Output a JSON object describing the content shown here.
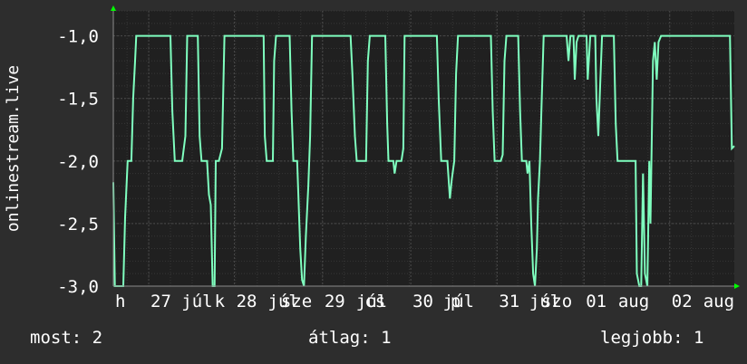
{
  "chart_data": {
    "type": "line",
    "ylabel": "onlinestream.live",
    "ylim": [
      -3.0,
      -0.8
    ],
    "y_ticks": [
      {
        "value": -1.0,
        "label": "-1,0"
      },
      {
        "value": -1.5,
        "label": "-1,5"
      },
      {
        "value": -2.0,
        "label": "-2,0"
      },
      {
        "value": -2.5,
        "label": "-2,5"
      },
      {
        "value": -3.0,
        "label": "-3,0"
      }
    ],
    "xlim": [
      0,
      100
    ],
    "x_ticks": [
      {
        "value": 0.0,
        "label": "h"
      },
      {
        "value": 5.7,
        "label": "27"
      },
      {
        "value": 10.7,
        "label": "júl"
      },
      {
        "value": 16.0,
        "label": "k"
      },
      {
        "value": 19.5,
        "label": "28"
      },
      {
        "value": 24.6,
        "label": "júl"
      },
      {
        "value": 26.7,
        "label": "sze"
      },
      {
        "value": 33.7,
        "label": "29"
      },
      {
        "value": 38.8,
        "label": "júl"
      },
      {
        "value": 40.2,
        "label": "cs"
      },
      {
        "value": 47.9,
        "label": "30"
      },
      {
        "value": 52.8,
        "label": "júl"
      },
      {
        "value": 54.0,
        "label": "p"
      },
      {
        "value": 61.8,
        "label": "31"
      },
      {
        "value": 66.7,
        "label": "júl"
      },
      {
        "value": 68.6,
        "label": "szo"
      },
      {
        "value": 75.8,
        "label": "01"
      },
      {
        "value": 81.0,
        "label": "aug"
      },
      {
        "value": 89.6,
        "label": "02"
      },
      {
        "value": 94.7,
        "label": "aug"
      }
    ],
    "grid": true,
    "series": [
      {
        "color": "#7fffbf",
        "points": [
          [
            0.0,
            -2.17
          ],
          [
            0.25,
            -3.0
          ],
          [
            1.6,
            -3.0
          ],
          [
            1.9,
            -2.45
          ],
          [
            2.3,
            -2.0
          ],
          [
            2.9,
            -2.0
          ],
          [
            3.2,
            -1.5
          ],
          [
            3.5,
            -1.2
          ],
          [
            3.7,
            -1.0
          ],
          [
            9.2,
            -1.0
          ],
          [
            9.5,
            -1.6
          ],
          [
            9.9,
            -2.0
          ],
          [
            11.1,
            -2.0
          ],
          [
            11.6,
            -1.8
          ],
          [
            11.9,
            -1.0
          ],
          [
            13.6,
            -1.0
          ],
          [
            13.9,
            -1.8
          ],
          [
            14.2,
            -2.0
          ],
          [
            15.1,
            -2.0
          ],
          [
            15.4,
            -2.27
          ],
          [
            15.7,
            -2.35
          ],
          [
            16.0,
            -3.0
          ],
          [
            16.3,
            -3.0
          ],
          [
            16.5,
            -2.0
          ],
          [
            17.0,
            -2.0
          ],
          [
            17.5,
            -1.9
          ],
          [
            17.9,
            -1.0
          ],
          [
            24.2,
            -1.0
          ],
          [
            24.4,
            -1.8
          ],
          [
            24.7,
            -2.0
          ],
          [
            25.7,
            -2.0
          ],
          [
            25.9,
            -1.2
          ],
          [
            26.2,
            -1.0
          ],
          [
            28.4,
            -1.0
          ],
          [
            28.7,
            -1.6
          ],
          [
            29.0,
            -2.0
          ],
          [
            29.6,
            -2.0
          ],
          [
            30.1,
            -2.7
          ],
          [
            30.4,
            -2.95
          ],
          [
            30.7,
            -3.0
          ],
          [
            31.0,
            -2.6
          ],
          [
            31.4,
            -2.2
          ],
          [
            31.7,
            -1.8
          ],
          [
            32.0,
            -1.0
          ],
          [
            38.2,
            -1.0
          ],
          [
            38.5,
            -1.3
          ],
          [
            38.9,
            -1.8
          ],
          [
            39.2,
            -2.0
          ],
          [
            40.7,
            -2.0
          ],
          [
            41.0,
            -1.2
          ],
          [
            41.3,
            -1.0
          ],
          [
            43.8,
            -1.0
          ],
          [
            44.1,
            -1.7
          ],
          [
            44.3,
            -2.0
          ],
          [
            45.1,
            -2.0
          ],
          [
            45.3,
            -2.1
          ],
          [
            45.6,
            -2.0
          ],
          [
            46.4,
            -2.0
          ],
          [
            46.7,
            -1.9
          ],
          [
            46.9,
            -1.0
          ],
          [
            52.1,
            -1.0
          ],
          [
            52.4,
            -1.5
          ],
          [
            52.8,
            -2.0
          ],
          [
            53.8,
            -2.0
          ],
          [
            54.2,
            -2.3
          ],
          [
            54.5,
            -2.15
          ],
          [
            54.9,
            -2.0
          ],
          [
            55.2,
            -1.3
          ],
          [
            55.5,
            -1.0
          ],
          [
            60.8,
            -1.0
          ],
          [
            61.1,
            -1.6
          ],
          [
            61.4,
            -2.0
          ],
          [
            62.4,
            -2.0
          ],
          [
            62.7,
            -1.95
          ],
          [
            63.0,
            -1.2
          ],
          [
            63.3,
            -1.0
          ],
          [
            65.2,
            -1.0
          ],
          [
            65.5,
            -1.6
          ],
          [
            65.8,
            -2.0
          ],
          [
            66.5,
            -2.0
          ],
          [
            66.7,
            -2.1
          ],
          [
            67.0,
            -2.0
          ],
          [
            67.3,
            -2.5
          ],
          [
            67.6,
            -2.9
          ],
          [
            67.9,
            -3.0
          ],
          [
            68.2,
            -2.7
          ],
          [
            68.4,
            -2.3
          ],
          [
            68.7,
            -2.0
          ],
          [
            69.0,
            -1.5
          ],
          [
            69.3,
            -1.0
          ],
          [
            73.0,
            -1.0
          ],
          [
            73.3,
            -1.2
          ],
          [
            73.6,
            -1.0
          ],
          [
            74.1,
            -1.0
          ],
          [
            74.3,
            -1.35
          ],
          [
            74.6,
            -1.05
          ],
          [
            74.9,
            -1.0
          ],
          [
            76.2,
            -1.0
          ],
          [
            76.4,
            -1.35
          ],
          [
            76.8,
            -1.0
          ],
          [
            77.6,
            -1.0
          ],
          [
            77.8,
            -1.5
          ],
          [
            78.1,
            -1.8
          ],
          [
            78.4,
            -1.4
          ],
          [
            78.7,
            -1.0
          ],
          [
            80.6,
            -1.0
          ],
          [
            80.9,
            -1.7
          ],
          [
            81.2,
            -2.0
          ],
          [
            84.1,
            -2.0
          ],
          [
            84.3,
            -2.9
          ],
          [
            84.7,
            -3.0
          ],
          [
            85.0,
            -3.0
          ],
          [
            85.3,
            -2.1
          ],
          [
            85.6,
            -2.9
          ],
          [
            86.0,
            -3.0
          ],
          [
            86.3,
            -2.0
          ],
          [
            86.5,
            -2.5
          ],
          [
            86.9,
            -1.2
          ],
          [
            87.2,
            -1.05
          ],
          [
            87.5,
            -1.35
          ],
          [
            87.8,
            -1.05
          ],
          [
            88.2,
            -1.0
          ],
          [
            99.3,
            -1.0
          ],
          [
            99.6,
            -1.9
          ],
          [
            100.0,
            -1.88
          ]
        ]
      }
    ]
  },
  "footer": {
    "current": "most: 2",
    "average": "átlag: 1",
    "best": "legjobb: 1"
  },
  "colors": {
    "background": "#2d2d2d",
    "plot_background": "#202020",
    "grid_major": "#4a4a4a",
    "grid_minor": "#363636",
    "line": "#7fffbf",
    "axis_arrow": "#00ff00"
  }
}
